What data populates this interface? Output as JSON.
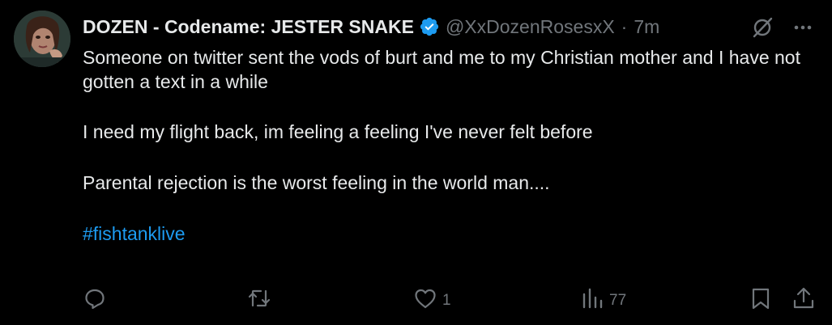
{
  "tweet": {
    "display_name": "DOZEN - Codename: JESTER SNAKE",
    "handle": "@XxDozenRosesxX",
    "separator": "·",
    "time": "7m",
    "paragraphs": [
      "Someone on twitter sent the vods of burt and me to my Christian mother and I have not gotten a text in a while",
      "I need my flight back, im feeling a feeling I've never felt before",
      "Parental rejection is the worst feeling in the world man...."
    ],
    "hashtag": "#fishtanklive",
    "avatar_icon": "user-avatar",
    "verified_icon": "verified-badge-icon",
    "colors": {
      "background": "#000000",
      "text": "#e7e9ea",
      "muted": "#71767b",
      "accent": "#1d9bf0"
    }
  },
  "actions": {
    "reply_icon": "reply-icon",
    "retweet_icon": "retweet-icon",
    "like_icon": "heart-icon",
    "like_count": "1",
    "views_icon": "views-chart-icon",
    "views_count": "77",
    "bookmark_icon": "bookmark-icon",
    "share_icon": "share-icon"
  },
  "top_right": {
    "grok_icon": "grok-icon",
    "more_icon": "more-dots-icon"
  }
}
